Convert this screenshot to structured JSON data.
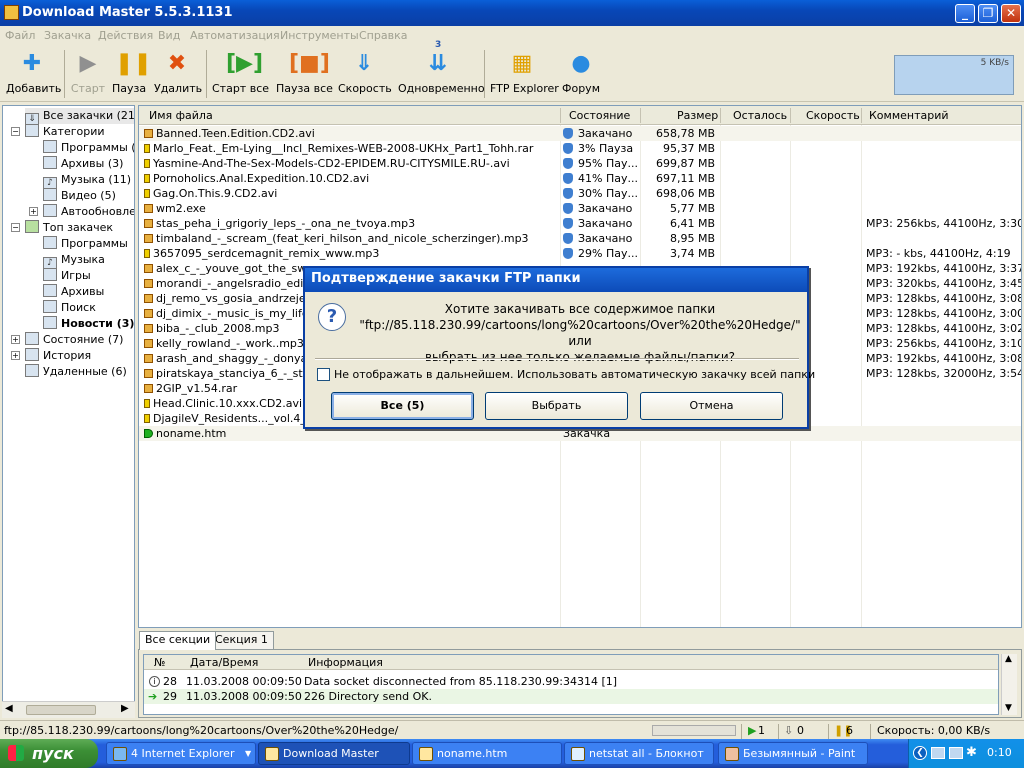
{
  "window": {
    "title": "Download Master 5.5.3.1131",
    "controls": {
      "minimize": "_",
      "maximize": "❐",
      "close": "✕"
    }
  },
  "menu": [
    "Файл",
    "Закачка",
    "Действия",
    "Вид",
    "Автоматизация",
    "Инструменты",
    "Справка"
  ],
  "toolbar": {
    "add": "Добавить",
    "start": "Старт",
    "pause": "Пауза",
    "delete": "Удалить",
    "start_all": "Старт все",
    "pause_all": "Пауза все",
    "speed": "Скорость",
    "simultaneous": "Одновременно",
    "simultaneous_count": "3",
    "ftp_explorer": "FTP Explorer",
    "forum": "Форум",
    "speed_readout": "5 KB/s"
  },
  "tree": {
    "all": "Все закачки (21)",
    "categories": "Категории",
    "programs": "Программы (1",
    "archives": "Архивы (3)",
    "music": "Музыка (11)",
    "video": "Видео (5)",
    "auto": "Автообновле",
    "top": "Топ закачек",
    "top_programs": "Программы",
    "top_music": "Музыка",
    "top_games": "Игры",
    "top_archives": "Архивы",
    "top_search": "Поиск",
    "top_news": "Новости (3)",
    "state": "Состояние (7)",
    "history": "История",
    "deleted": "Удаленные (6)"
  },
  "columns": {
    "name": "Имя файла",
    "state": "Состояние",
    "size": "Размер",
    "left": "Осталось",
    "speed": "Скорость",
    "comment": "Комментарий"
  },
  "files": [
    {
      "name": "Banned.Teen.Edition.CD2.avi",
      "state": "Закачано",
      "size": "658,78 MB",
      "comment": "",
      "icon": "done"
    },
    {
      "name": "Marlo_Feat._Em-Lying__Incl_Remixes-WEB-2008-UKHx_Part1_Tohh.rar",
      "state": "3% Пауза",
      "size": "95,37 MB",
      "comment": "",
      "icon": "pause"
    },
    {
      "name": "Yasmine-And-The-Sex-Models-CD2-EPIDEM.RU-CITYSMILE.RU-.avi",
      "state": "95% Пау...",
      "size": "699,87 MB",
      "comment": "",
      "icon": "pause"
    },
    {
      "name": "Pornoholics.Anal.Expedition.10.CD2.avi",
      "state": "41% Пау...",
      "size": "697,11 MB",
      "comment": "",
      "icon": "pause"
    },
    {
      "name": "Gag.On.This.9.CD2.avi",
      "state": "30% Пау...",
      "size": "698,06 MB",
      "comment": "",
      "icon": "pause"
    },
    {
      "name": "wm2.exe",
      "state": "Закачано",
      "size": "5,77 MB",
      "comment": "",
      "icon": "done"
    },
    {
      "name": "stas_peha_i_grigoriy_leps_-_ona_ne_tvoya.mp3",
      "state": "Закачано",
      "size": "6,41 MB",
      "comment": "MP3: 256kbs, 44100Hz, 3:30",
      "icon": "done"
    },
    {
      "name": "timbaland_-_scream_(feat_keri_hilson_and_nicole_scherzinger).mp3",
      "state": "Закачано",
      "size": "8,95 MB",
      "comment": "",
      "icon": "done"
    },
    {
      "name": "3657095_serdcemagnit_remix_www.mp3",
      "state": "29% Пау...",
      "size": "3,74 MB",
      "comment": "MP3: - kbs, 44100Hz, 4:19",
      "icon": "pause"
    },
    {
      "name": "alex_c_-_youve_got_the_swe",
      "state": "",
      "size": "",
      "comment": "MP3: 192kbs, 44100Hz, 3:37",
      "icon": "done"
    },
    {
      "name": "morandi_-_angelsradio_edit.mp",
      "state": "",
      "size": "",
      "comment": "MP3: 320kbs, 44100Hz, 3:45",
      "icon": "done"
    },
    {
      "name": "dj_remo_vs_gosia_andrzejew",
      "state": "",
      "size": "",
      "comment": "MP3: 128kbs, 44100Hz, 3:08",
      "icon": "done"
    },
    {
      "name": "dj_dimix_-_music_is_my_life_r",
      "state": "",
      "size": "",
      "comment": "MP3: 128kbs, 44100Hz, 3:00",
      "icon": "done"
    },
    {
      "name": "biba_-_club_2008.mp3",
      "state": "",
      "size": "",
      "comment": "MP3: 128kbs, 44100Hz, 3:02",
      "icon": "done"
    },
    {
      "name": "kelly_rowland_-_work..mp3",
      "state": "",
      "size": "",
      "comment": "MP3: 256kbs, 44100Hz, 3:10",
      "icon": "done"
    },
    {
      "name": "arash_and_shaggy_-_donya.r",
      "state": "",
      "size": "",
      "comment": "MP3: 192kbs, 44100Hz, 3:08",
      "icon": "done"
    },
    {
      "name": "piratskaya_stanciya_6_-_stim",
      "state": "",
      "size": "",
      "comment": "MP3: 128kbs, 32000Hz, 3:54",
      "icon": "done"
    },
    {
      "name": "2GIP_v1.54.rar",
      "state": "",
      "size": "",
      "comment": "",
      "icon": "done"
    },
    {
      "name": "Head.Clinic.10.xxx.CD2.avi",
      "state": "",
      "size": "",
      "comment": "",
      "icon": "pause"
    },
    {
      "name": "DjagileV_Residents..._vol.4_",
      "state": "",
      "size": "",
      "comment": "",
      "icon": "pause"
    },
    {
      "name": "noname.htm",
      "state": "Закачка",
      "size": "",
      "comment": "",
      "icon": "play"
    }
  ],
  "tabs": [
    "Все секции",
    "Секция 1"
  ],
  "log": {
    "headers": {
      "no": "№",
      "datetime": "Дата/Время",
      "info": "Информация"
    },
    "rows": [
      {
        "no": "28",
        "datetime": "11.03.2008 00:09:50",
        "info": "Data socket disconnected from 85.118.230.99:34314 [1]",
        "icon": "i"
      },
      {
        "no": "29",
        "datetime": "11.03.2008 00:09:50",
        "info": "226 Directory send OK.",
        "icon": "arrow"
      }
    ]
  },
  "status": {
    "url": "ftp://85.118.230.99/cartoons/long%20cartoons/Over%20the%20Hedge/",
    "active": "1",
    "queued": "0",
    "paused": "6",
    "speed": "Скорость: 0,00 KB/s"
  },
  "dialog": {
    "title": "Подтверждение закачки FTP папки",
    "line1": "Хотите закачивать все содержимое папки",
    "line2": "\"ftp://85.118.230.99/cartoons/long%20cartoons/Over%20the%20Hedge/\" или",
    "line3": "выбрать из нее только желаемые файлы/папки?",
    "checkbox": "Не отображать в дальнейшем. Использовать автоматическую закачку всей папки",
    "btn_all": "Все (5)",
    "btn_choose": "Выбрать",
    "btn_cancel": "Отмена"
  },
  "taskbar": {
    "start": "пуск",
    "tasks": [
      "4 Internet Explorer",
      "Download Master",
      "noname.htm",
      "netstat all - Блокнот",
      "Безымянный - Paint"
    ],
    "clock": "0:10"
  },
  "colors": {
    "highlight_row": "#f5f4ec",
    "titlebar": "#0a4fc8",
    "paused": "#f0d000",
    "done": "#3f7fd0"
  }
}
